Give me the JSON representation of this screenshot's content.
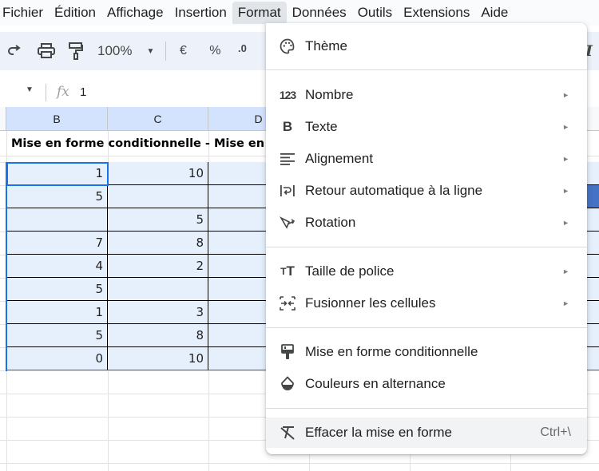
{
  "menubar": {
    "items": [
      "Fichier",
      "Édition",
      "Affichage",
      "Insertion",
      "Format",
      "Données",
      "Outils",
      "Extensions",
      "Aide"
    ],
    "active": "Format"
  },
  "toolbar": {
    "zoom": "100%",
    "currency": "€",
    "percent": "%",
    "decimal": ".0",
    "italic": "I"
  },
  "formula_bar": {
    "fx": "fx",
    "value": "1"
  },
  "grid": {
    "columns": [
      "B",
      "C",
      "D"
    ],
    "title": "Mise en forme conditionnelle - Mise en su",
    "rows": [
      {
        "b": "1",
        "c": "10"
      },
      {
        "b": "5",
        "c": ""
      },
      {
        "b": "",
        "c": "5"
      },
      {
        "b": "7",
        "c": "8"
      },
      {
        "b": "4",
        "c": "2"
      },
      {
        "b": "5",
        "c": ""
      },
      {
        "b": "1",
        "c": "3"
      },
      {
        "b": "5",
        "c": "8"
      },
      {
        "b": "0",
        "c": "10"
      }
    ]
  },
  "format_menu": {
    "items": [
      {
        "label": "Thème",
        "icon": "palette-icon",
        "submenu": false
      },
      {
        "label": "Nombre",
        "icon": "number-123-icon",
        "submenu": true
      },
      {
        "label": "Texte",
        "icon": "bold-icon",
        "submenu": true
      },
      {
        "label": "Alignement",
        "icon": "align-left-icon",
        "submenu": true
      },
      {
        "label": "Retour automatique à la ligne",
        "icon": "text-wrap-icon",
        "submenu": true
      },
      {
        "label": "Rotation",
        "icon": "text-rotation-icon",
        "submenu": true
      },
      {
        "label": "Taille de police",
        "icon": "font-size-icon",
        "submenu": true
      },
      {
        "label": "Fusionner les cellules",
        "icon": "merge-cells-icon",
        "submenu": true
      },
      {
        "label": "Mise en forme conditionnelle",
        "icon": "paint-roller-icon",
        "submenu": false
      },
      {
        "label": "Couleurs en alternance",
        "icon": "drop-half-icon",
        "submenu": false
      },
      {
        "label": "Effacer la mise en forme",
        "icon": "clear-format-icon",
        "submenu": false,
        "shortcut": "Ctrl+\\"
      }
    ],
    "number_icon_text": "123",
    "bold_icon_text": "B",
    "font_size_icon_text": "тT",
    "arrow": "►"
  },
  "colors": {
    "selection_fill": "#e6effc",
    "selection_border": "#1a73e8",
    "header_selected": "#d3e3fd",
    "toolbar_bg": "#edf2fa",
    "accent_blue": "#4472c4"
  }
}
